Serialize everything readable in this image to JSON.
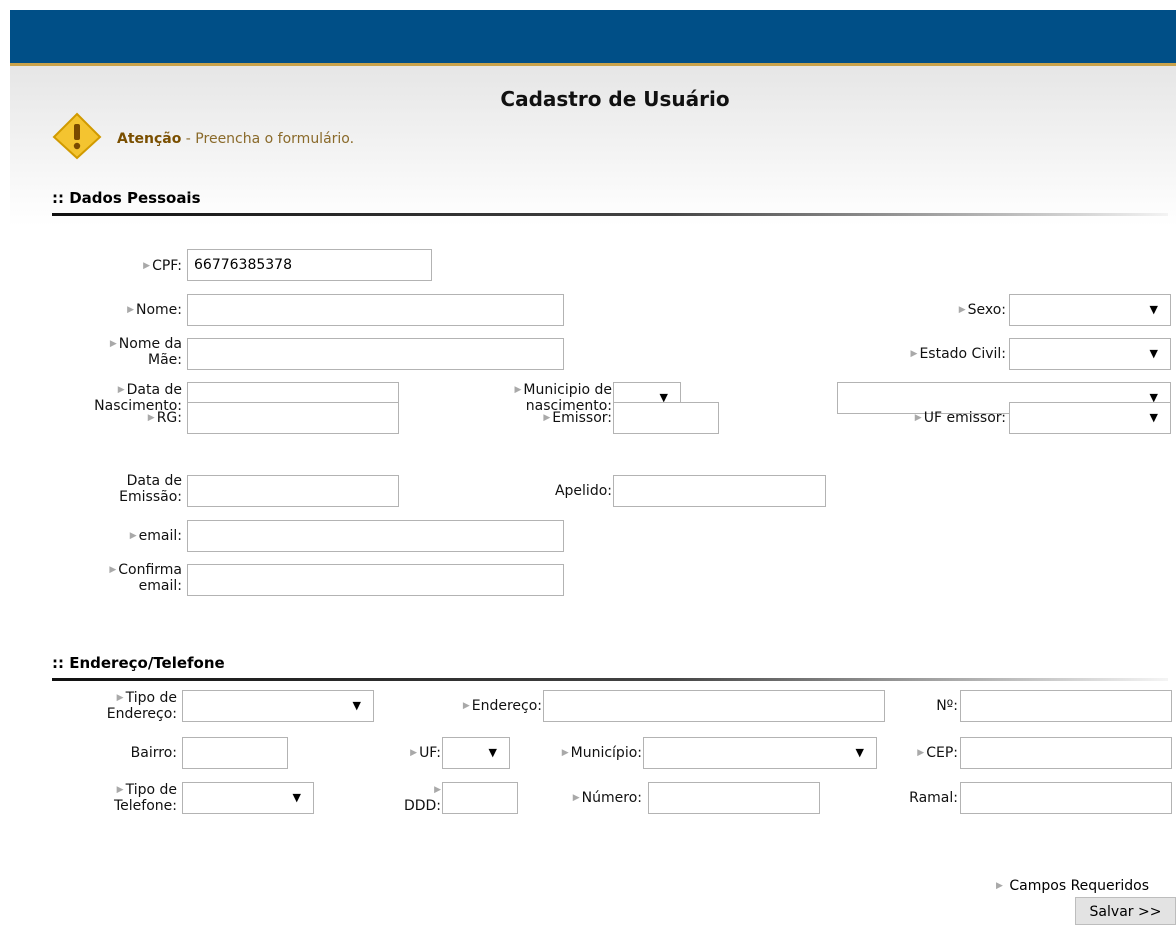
{
  "page": {
    "title": "Cadastro de Usuário"
  },
  "notice": {
    "strong": "Atenção",
    "text": " - Preencha o formulário."
  },
  "sections": {
    "personal": ":: Dados Pessoais",
    "address": ":: Endereço/Telefone"
  },
  "personal": {
    "cpf": {
      "label": "CPF:",
      "value": "66776385378"
    },
    "nome": {
      "label": "Nome:",
      "value": ""
    },
    "sexo": {
      "label": "Sexo:",
      "value": ""
    },
    "nome_mae": {
      "label": "Nome da\nMãe:",
      "value": ""
    },
    "estado_civil": {
      "label": "Estado Civil:",
      "value": ""
    },
    "data_nascimento": {
      "label": "Data de\nNascimento:",
      "value": ""
    },
    "municipio_nascimento": {
      "label": "Municipio de\nnascimento:",
      "value": ""
    },
    "municipio_nascimento_cidade": {
      "value": ""
    },
    "rg": {
      "label": "RG:",
      "value": ""
    },
    "emissor": {
      "label": "Emissor:",
      "value": ""
    },
    "uf_emissor": {
      "label": "UF emissor:",
      "value": ""
    },
    "data_emissao": {
      "label": "Data de\nEmissão:",
      "value": ""
    },
    "apelido": {
      "label": "Apelido:",
      "value": ""
    },
    "email": {
      "label": "email:",
      "value": ""
    },
    "confirma_email": {
      "label": "Confirma\nemail:",
      "value": ""
    }
  },
  "address": {
    "tipo_endereco": {
      "label": "Tipo de\nEndereço:",
      "value": ""
    },
    "endereco": {
      "label": "Endereço:",
      "value": ""
    },
    "numero_end": {
      "label": "Nº:",
      "value": ""
    },
    "bairro": {
      "label": "Bairro:",
      "value": ""
    },
    "uf": {
      "label": "UF:",
      "value": ""
    },
    "municipio": {
      "label": "Município:",
      "value": ""
    },
    "cep": {
      "label": "CEP:",
      "value": ""
    },
    "tipo_telefone": {
      "label": "Tipo de\nTelefone:",
      "value": ""
    },
    "ddd": {
      "label": "DDD:",
      "value": ""
    },
    "numero_tel": {
      "label": "Número:",
      "value": ""
    },
    "ramal": {
      "label": "Ramal:",
      "value": ""
    }
  },
  "footer": {
    "required_note": "Campos Requeridos",
    "save_button": "Salvar >>"
  },
  "icons": {
    "marker": "triangle-right-icon",
    "dropdown": "dropdown-arrow-icon",
    "warning": "warning-icon"
  },
  "colors": {
    "header_bar": "#004f87",
    "accent_line": "#c9a24a",
    "notice_text": "#8a6a2a"
  }
}
